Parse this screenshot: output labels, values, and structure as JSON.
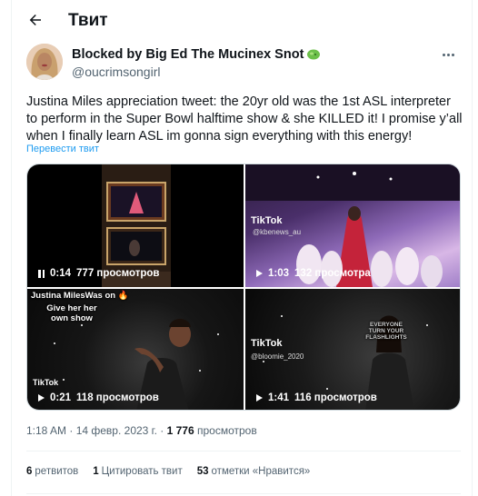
{
  "header": {
    "title": "Твит",
    "back_icon": "arrow-left-icon"
  },
  "author": {
    "name": "Blocked by Big Ed The Mucinex Snot",
    "name_emoji_icon": "green-blob-emoji-icon",
    "handle": "@oucrimsongirl"
  },
  "tweet": {
    "text": "Justina Miles appreciation tweet: the 20yr old was the 1st ASL interpreter to perform in the Super Bowl halftime show & she KILLED it! I promise y’all when I finally learn ASL im gonna sign everything with this energy!",
    "translate_label": "Перевести твит"
  },
  "media": [
    {
      "state": "paused",
      "time": "0:14",
      "views": "777 просмотров"
    },
    {
      "state": "play",
      "time": "1:03",
      "views": "132 просмотра",
      "watermark": "TikTok",
      "watermark_handle": "@kbenews_au"
    },
    {
      "state": "play",
      "time": "0:21",
      "views": "118 просмотров",
      "caption_lines": [
        "Justina MilesWas on 🔥",
        "Give her her",
        "own show"
      ],
      "watermark": "TikTok"
    },
    {
      "state": "play",
      "time": "1:41",
      "views": "116 просмотров",
      "watermark": "TikTok",
      "watermark_handle": "@bloomie_2020",
      "caption_lines": [
        "EVERYONE",
        "TURN YOUR",
        "FLASHLIGHTS"
      ]
    }
  ],
  "meta": {
    "time": "1:18 AM",
    "date": "14 февр. 2023 г.",
    "views_count": "1 776",
    "views_label": "просмотров"
  },
  "stats": {
    "retweets_count": "6",
    "retweets_label": "ретвитов",
    "quotes_count": "1",
    "quotes_label": "Цитировать твит",
    "likes_count": "53",
    "likes_label": "отметки «Нравится»"
  },
  "colors": {
    "accent": "#1d9bf0",
    "text": "#0f1419",
    "secondary": "#536471",
    "border": "#eff3f4"
  }
}
